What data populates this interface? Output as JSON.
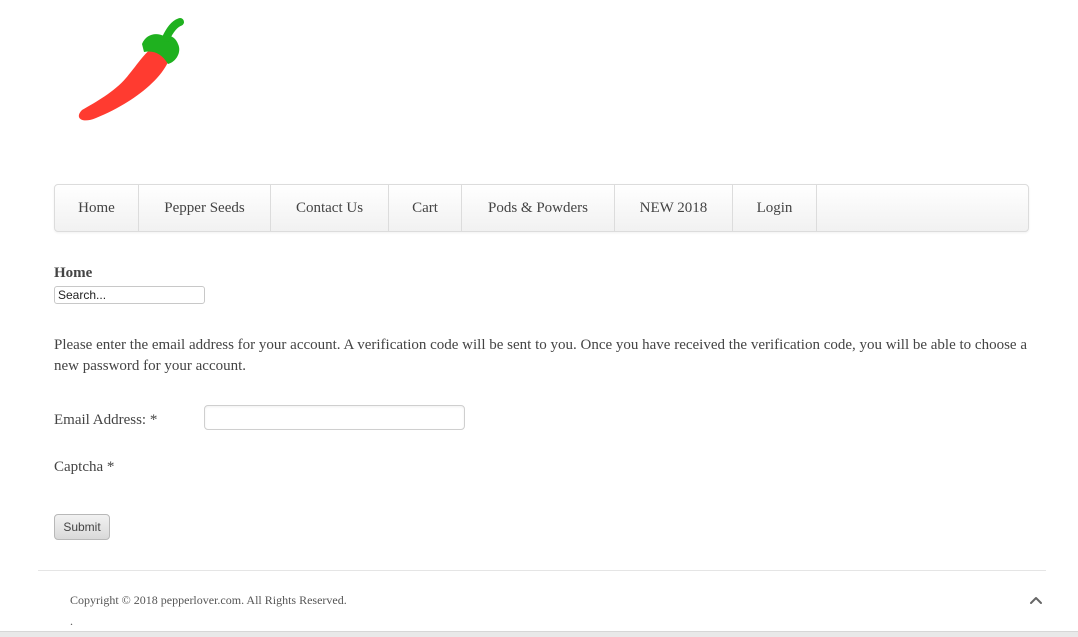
{
  "logo": {
    "icon": "chili-pepper-icon",
    "colors": {
      "pepper": "#ff3b30",
      "stem": "#1fb11f"
    }
  },
  "nav": {
    "items": [
      {
        "label": "Home"
      },
      {
        "label": "Pepper Seeds"
      },
      {
        "label": "Contact Us"
      },
      {
        "label": "Cart"
      },
      {
        "label": "Pods & Powders"
      },
      {
        "label": "NEW 2018"
      },
      {
        "label": "Login"
      }
    ]
  },
  "breadcrumb": {
    "current": "Home"
  },
  "search": {
    "placeholder": "Search..."
  },
  "reset_form": {
    "intro": "Please enter the email address for your account. A verification code will be sent to you. Once you have received the verification code, you will be able to choose a new password for your account.",
    "email_label": "Email Address: *",
    "email_value": "",
    "captcha_label": "Captcha *",
    "submit_label": "Submit"
  },
  "footer": {
    "copyright": "Copyright © 2018 pepperlover.com. All Rights Reserved.",
    "dot": ".",
    "to_top_icon": "chevron-up-icon"
  }
}
